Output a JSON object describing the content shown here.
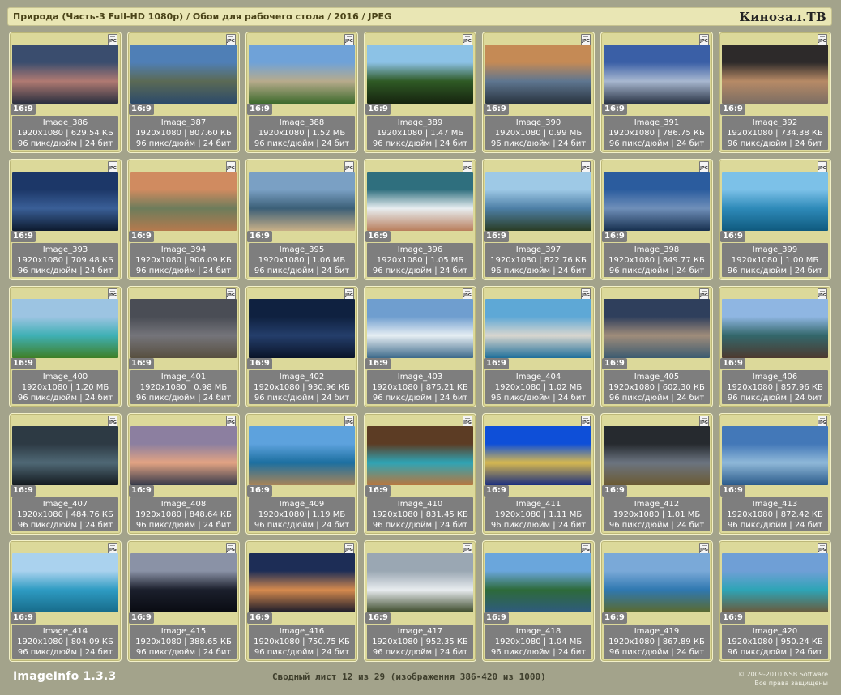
{
  "header": {
    "title": "Природа (Часть-3 Full-HD 1080р) / Обои для рабочего стола / 2016 / JPEG",
    "brand": "Кинозал.ТВ"
  },
  "footer": {
    "app": "ImageInfo 1.3.3",
    "summary": "Сводный лист 12 из 29 (изображения 386-420 из 1000)",
    "copyright": "© 2009-2010 NSB Software",
    "rights": "Все права защищены"
  },
  "badge_text": "JPG",
  "ratio_text": "16:9",
  "items": [
    {
      "name": "Image_386",
      "size": "1920x1080 | 629.54 КБ",
      "meta": "96 пикс/дюйм | 24 бит",
      "colors": [
        "#3a4d6e",
        "#b07a72",
        "#2a2f3f"
      ]
    },
    {
      "name": "Image_387",
      "size": "1920x1080 | 807.60 КБ",
      "meta": "96 пикс/дюйм | 24 бит",
      "colors": [
        "#4f7fb6",
        "#5b6a55",
        "#2c4a6a"
      ]
    },
    {
      "name": "Image_388",
      "size": "1920x1080 | 1.52 МБ",
      "meta": "96 пикс/дюйм | 24 бит",
      "colors": [
        "#6fa2d8",
        "#b7ab8c",
        "#3d6a2c"
      ]
    },
    {
      "name": "Image_389",
      "size": "1920x1080 | 1.47 МБ",
      "meta": "96 пикс/дюйм | 24 бит",
      "colors": [
        "#8cc2e6",
        "#2f5a25",
        "#16240f"
      ]
    },
    {
      "name": "Image_390",
      "size": "1920x1080 | 0.99 МБ",
      "meta": "96 пикс/дюйм | 24 бит",
      "colors": [
        "#c58a55",
        "#5f7690",
        "#28333f"
      ]
    },
    {
      "name": "Image_391",
      "size": "1920x1080 | 786.75 КБ",
      "meta": "96 пикс/дюйм | 24 бит",
      "colors": [
        "#3a5fa6",
        "#a8b8d0",
        "#2a3446"
      ]
    },
    {
      "name": "Image_392",
      "size": "1920x1080 | 734.38 КБ",
      "meta": "96 пикс/дюйм | 24 бит",
      "colors": [
        "#2d2a2a",
        "#b78a66",
        "#7c6e63"
      ]
    },
    {
      "name": "Image_393",
      "size": "1920x1080 | 709.48 КБ",
      "meta": "96 пикс/дюйм | 24 бит",
      "colors": [
        "#1c3768",
        "#3a5f97",
        "#0d1a2e"
      ]
    },
    {
      "name": "Image_394",
      "size": "1920x1080 | 906.09 КБ",
      "meta": "96 пикс/дюйм | 24 бит",
      "colors": [
        "#d08b60",
        "#6d7c5b",
        "#b57a4e"
      ]
    },
    {
      "name": "Image_395",
      "size": "1920x1080 | 1.06 МБ",
      "meta": "96 пикс/дюйм | 24 бит",
      "colors": [
        "#7aa0c4",
        "#3b5f77",
        "#c9b087"
      ]
    },
    {
      "name": "Image_396",
      "size": "1920x1080 | 1.05 МБ",
      "meta": "96 пикс/дюйм | 24 бит",
      "colors": [
        "#2f6f7e",
        "#e8eef1",
        "#b97e5c"
      ]
    },
    {
      "name": "Image_397",
      "size": "1920x1080 | 822.76 КБ",
      "meta": "96 пикс/дюйм | 24 бит",
      "colors": [
        "#9ec9e6",
        "#4d7fa6",
        "#2a3c24"
      ]
    },
    {
      "name": "Image_398",
      "size": "1920x1080 | 849.77 КБ",
      "meta": "96 пикс/дюйм | 24 бит",
      "colors": [
        "#2b5c9e",
        "#6f8fb9",
        "#17304f"
      ]
    },
    {
      "name": "Image_399",
      "size": "1920x1080 | 1.00 МБ",
      "meta": "96 пикс/дюйм | 24 бит",
      "colors": [
        "#7cc1e8",
        "#2e8ab9",
        "#0f5a7e"
      ]
    },
    {
      "name": "Image_400",
      "size": "1920x1080 | 1.20 МБ",
      "meta": "96 пикс/дюйм | 24 бит",
      "colors": [
        "#9cc4e2",
        "#3fb0b5",
        "#3f7f26"
      ]
    },
    {
      "name": "Image_401",
      "size": "1920x1080 | 0.98 МБ",
      "meta": "96 пикс/дюйм | 24 бит",
      "colors": [
        "#4a4d55",
        "#74747a",
        "#584f3f"
      ]
    },
    {
      "name": "Image_402",
      "size": "1920x1080 | 930.96 КБ",
      "meta": "96 пикс/дюйм | 24 бит",
      "colors": [
        "#0f2140",
        "#243e6b",
        "#0a1428"
      ]
    },
    {
      "name": "Image_403",
      "size": "1920x1080 | 875.21 КБ",
      "meta": "96 пикс/дюйм | 24 бит",
      "colors": [
        "#6f9ecf",
        "#e6eef3",
        "#3d6a8a"
      ]
    },
    {
      "name": "Image_404",
      "size": "1920x1080 | 1.02 МБ",
      "meta": "96 пикс/дюйм | 24 бит",
      "colors": [
        "#5ea8d6",
        "#d8d6cf",
        "#1f6f9a"
      ]
    },
    {
      "name": "Image_405",
      "size": "1920x1080 | 602.30 КБ",
      "meta": "96 пикс/дюйм | 24 бит",
      "colors": [
        "#2f3f5c",
        "#9f8c7a",
        "#3c5b70"
      ]
    },
    {
      "name": "Image_406",
      "size": "1920x1080 | 857.96 КБ",
      "meta": "96 пикс/дюйм | 24 бит",
      "colors": [
        "#8fb6e2",
        "#33676b",
        "#4d3a2f"
      ]
    },
    {
      "name": "Image_407",
      "size": "1920x1080 | 484.76 КБ",
      "meta": "96 пикс/дюйм | 24 бит",
      "colors": [
        "#2d3a44",
        "#4f6875",
        "#141a1f"
      ]
    },
    {
      "name": "Image_408",
      "size": "1920x1080 | 848.64 КБ",
      "meta": "96 пикс/дюйм | 24 бит",
      "colors": [
        "#8c7fa0",
        "#e2a383",
        "#363a4a"
      ]
    },
    {
      "name": "Image_409",
      "size": "1920x1080 | 1.19 МБ",
      "meta": "96 пикс/дюйм | 24 бит",
      "colors": [
        "#5da2dd",
        "#1c6fa0",
        "#a88458"
      ]
    },
    {
      "name": "Image_410",
      "size": "1920x1080 | 831.45 КБ",
      "meta": "96 пикс/дюйм | 24 бит",
      "colors": [
        "#5c3c24",
        "#2fa4b5",
        "#b7773f"
      ]
    },
    {
      "name": "Image_411",
      "size": "1920x1080 | 1.11 МБ",
      "meta": "96 пикс/дюйм | 24 бит",
      "colors": [
        "#0e4fd8",
        "#d6b850",
        "#1b2f7e"
      ]
    },
    {
      "name": "Image_412",
      "size": "1920x1080 | 1.01 МБ",
      "meta": "96 пикс/дюйм | 24 бит",
      "colors": [
        "#262a2f",
        "#6b7480",
        "#6b5a32"
      ]
    },
    {
      "name": "Image_413",
      "size": "1920x1080 | 872.42 КБ",
      "meta": "96 пикс/дюйм | 24 бит",
      "colors": [
        "#4378b8",
        "#8fb8d8",
        "#2a5a8a"
      ]
    },
    {
      "name": "Image_414",
      "size": "1920x1080 | 804.09 КБ",
      "meta": "96 пикс/дюйм | 24 бит",
      "colors": [
        "#aad2ee",
        "#2e9bc2",
        "#176b8a"
      ]
    },
    {
      "name": "Image_415",
      "size": "1920x1080 | 388.65 КБ",
      "meta": "96 пикс/дюйм | 24 бит",
      "colors": [
        "#8a92a6",
        "#1b1f2c",
        "#090b12"
      ]
    },
    {
      "name": "Image_416",
      "size": "1920x1080 | 750.75 КБ",
      "meta": "96 пикс/дюйм | 24 бит",
      "colors": [
        "#1d2d56",
        "#d58a4e",
        "#1b1b2a"
      ]
    },
    {
      "name": "Image_417",
      "size": "1920x1080 | 952.35 КБ",
      "meta": "96 пикс/дюйм | 24 бит",
      "colors": [
        "#9aa7b3",
        "#e8ecef",
        "#3c4a2a"
      ]
    },
    {
      "name": "Image_418",
      "size": "1920x1080 | 1.04 МБ",
      "meta": "96 пикс/дюйм | 24 бит",
      "colors": [
        "#6aa6dc",
        "#2d6a3a",
        "#2f5b7e"
      ]
    },
    {
      "name": "Image_419",
      "size": "1920x1080 | 867.89 КБ",
      "meta": "96 пикс/дюйм | 24 бит",
      "colors": [
        "#7aa9d8",
        "#2f78b0",
        "#5b6a2e"
      ]
    },
    {
      "name": "Image_420",
      "size": "1920x1080 | 950.24 КБ",
      "meta": "96 пикс/дюйм | 24 бит",
      "colors": [
        "#6f9fd6",
        "#2ea4b6",
        "#6a5a3c"
      ]
    }
  ]
}
